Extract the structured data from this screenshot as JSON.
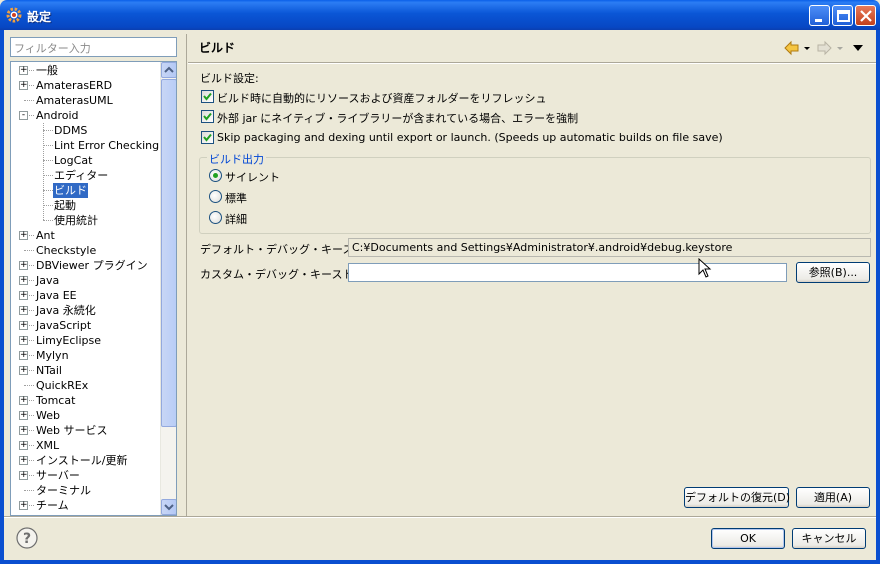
{
  "window": {
    "title": "設定"
  },
  "filter": {
    "placeholder": "フィルター入力"
  },
  "tree": {
    "items": [
      {
        "label": "一般",
        "expander": "+"
      },
      {
        "label": "AmaterasERD",
        "expander": "+"
      },
      {
        "label": "AmaterasUML",
        "expander": ""
      },
      {
        "label": "Android",
        "expander": "-"
      },
      {
        "label": "DDMS",
        "expander": ""
      },
      {
        "label": "Lint Error Checking",
        "expander": ""
      },
      {
        "label": "LogCat",
        "expander": ""
      },
      {
        "label": "エディター",
        "expander": ""
      },
      {
        "label": "ビルド",
        "expander": "",
        "selected": true
      },
      {
        "label": "起動",
        "expander": ""
      },
      {
        "label": "使用統計",
        "expander": ""
      },
      {
        "label": "Ant",
        "expander": "+"
      },
      {
        "label": "Checkstyle",
        "expander": ""
      },
      {
        "label": "DBViewer プラグイン",
        "expander": "+"
      },
      {
        "label": "Java",
        "expander": "+"
      },
      {
        "label": "Java EE",
        "expander": "+"
      },
      {
        "label": "Java 永続化",
        "expander": "+"
      },
      {
        "label": "JavaScript",
        "expander": "+"
      },
      {
        "label": "LimyEclipse",
        "expander": "+"
      },
      {
        "label": "Mylyn",
        "expander": "+"
      },
      {
        "label": "NTail",
        "expander": "+"
      },
      {
        "label": "QuickREx",
        "expander": ""
      },
      {
        "label": "Tomcat",
        "expander": "+"
      },
      {
        "label": "Web",
        "expander": "+"
      },
      {
        "label": "Web サービス",
        "expander": "+"
      },
      {
        "label": "XML",
        "expander": "+"
      },
      {
        "label": "インストール/更新",
        "expander": "+"
      },
      {
        "label": "サーバー",
        "expander": "+"
      },
      {
        "label": "ターミナル",
        "expander": ""
      },
      {
        "label": "チーム",
        "expander": "+"
      }
    ]
  },
  "page": {
    "title": "ビルド",
    "settings_label": "ビルド設定:",
    "checkboxes": [
      {
        "label": "ビルド時に自動的にリソースおよび資産フォルダーをリフレッシュ",
        "checked": true
      },
      {
        "label": "外部 jar にネイティブ・ライブラリーが含まれている場合、エラーを強制",
        "checked": true
      },
      {
        "label": "Skip packaging and dexing until export or launch. (Speeds up automatic builds on file save)",
        "checked": true
      }
    ],
    "output_group": {
      "title": "ビルド出力",
      "options": [
        {
          "label": "サイレント",
          "selected": true
        },
        {
          "label": "標準",
          "selected": false
        },
        {
          "label": "詳細",
          "selected": false
        }
      ]
    },
    "default_keystore": {
      "label": "デフォルト・デバッグ・キーストア:",
      "value": "C:¥Documents and Settings¥Administrator¥.android¥debug.keystore"
    },
    "custom_keystore": {
      "label": "カスタム・デバッグ・キーストア:",
      "value": ""
    },
    "browse_button": "参照(B)...",
    "restore_defaults_button": "デフォルトの復元(D)",
    "apply_button": "適用(A)"
  },
  "footer": {
    "ok_button": "OK",
    "cancel_button": "キャンセル"
  },
  "colors": {
    "titlebar": "#0a56d6",
    "selection": "#316ac5",
    "group_title": "#0046d5",
    "dialog_bg": "#ece9d8"
  }
}
